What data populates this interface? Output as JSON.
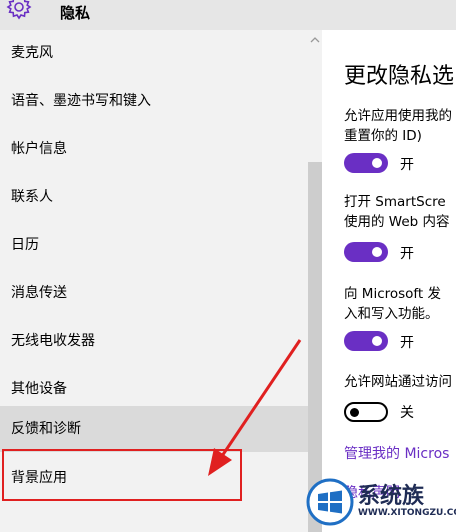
{
  "header": {
    "title": "隐私",
    "icon": "gear-icon"
  },
  "sidebar": {
    "items": [
      {
        "label": "麦克风"
      },
      {
        "label": "语音、墨迹书写和键入"
      },
      {
        "label": "帐户信息"
      },
      {
        "label": "联系人"
      },
      {
        "label": "日历"
      },
      {
        "label": "消息传送"
      },
      {
        "label": "无线电收发器"
      },
      {
        "label": "其他设备"
      },
      {
        "label": "反馈和诊断"
      },
      {
        "label": "背景应用"
      }
    ]
  },
  "main": {
    "title": "更改隐私选",
    "settings": [
      {
        "desc1": "允许应用使用我的",
        "desc2": "重置你的 ID)",
        "state": "开",
        "on": true
      },
      {
        "desc1": "打开 SmartScre",
        "desc2": "使用的 Web 内容",
        "state": "开",
        "on": true
      },
      {
        "desc1": "向 Microsoft 发",
        "desc2": "入和写入功能。",
        "state": "开",
        "on": true
      },
      {
        "desc1": "允许网站通过访问",
        "state": "关",
        "on": false
      }
    ],
    "link1": "管理我的 Micros",
    "link2": "隐私声明"
  },
  "watermark": {
    "text": "系统族",
    "url": "WWW.XITONGZU.COM"
  },
  "colors": {
    "accent": "#6a2fc4",
    "highlight": "#e02020"
  }
}
